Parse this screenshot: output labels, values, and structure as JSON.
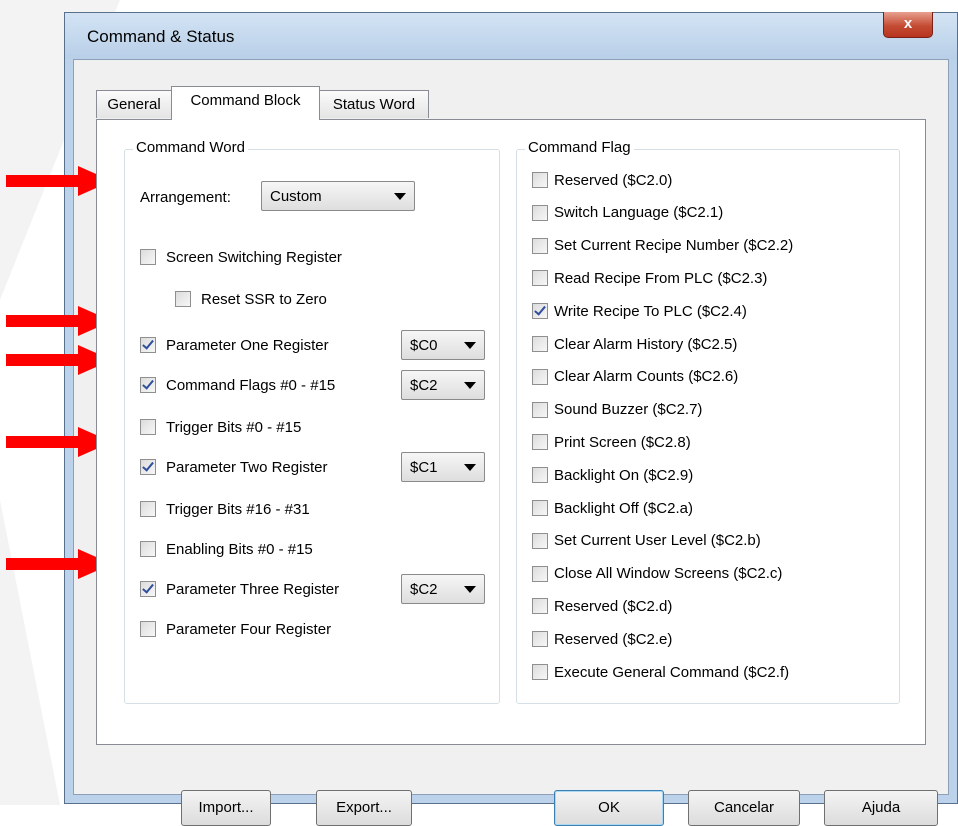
{
  "window": {
    "title": "Command & Status",
    "close_symbol": "x"
  },
  "tabs": [
    {
      "label": "General",
      "active": false
    },
    {
      "label": "Command Block",
      "active": true
    },
    {
      "label": "Status Word",
      "active": false
    }
  ],
  "command_word": {
    "legend": "Command Word",
    "arrangement_label": "Arrangement:",
    "arrangement_value": "Custom",
    "items": [
      {
        "label": "Screen Switching Register",
        "checked": false,
        "combo": null
      },
      {
        "label": "Reset SSR to Zero",
        "checked": false,
        "combo": null
      },
      {
        "label": "Parameter One Register",
        "checked": true,
        "combo": "$C0"
      },
      {
        "label": "Command Flags #0 - #15",
        "checked": true,
        "combo": "$C2"
      },
      {
        "label": "Trigger Bits #0 - #15",
        "checked": false,
        "combo": null
      },
      {
        "label": "Parameter Two Register",
        "checked": true,
        "combo": "$C1"
      },
      {
        "label": "Trigger Bits #16 - #31",
        "checked": false,
        "combo": null
      },
      {
        "label": "Enabling Bits #0 - #15",
        "checked": false,
        "combo": null
      },
      {
        "label": "Parameter Three Register",
        "checked": true,
        "combo": "$C2"
      },
      {
        "label": "Parameter Four Register",
        "checked": false,
        "combo": null
      }
    ]
  },
  "command_flag": {
    "legend": "Command Flag",
    "items": [
      {
        "label": "Reserved ($C2.0)",
        "checked": false
      },
      {
        "label": "Switch Language ($C2.1)",
        "checked": false
      },
      {
        "label": "Set Current Recipe Number ($C2.2)",
        "checked": false
      },
      {
        "label": "Read Recipe From PLC ($C2.3)",
        "checked": false
      },
      {
        "label": "Write Recipe To PLC ($C2.4)",
        "checked": true
      },
      {
        "label": "Clear Alarm History ($C2.5)",
        "checked": false
      },
      {
        "label": "Clear Alarm Counts ($C2.6)",
        "checked": false
      },
      {
        "label": "Sound Buzzer ($C2.7)",
        "checked": false
      },
      {
        "label": "Print Screen ($C2.8)",
        "checked": false
      },
      {
        "label": "Backlight On ($C2.9)",
        "checked": false
      },
      {
        "label": "Backlight Off ($C2.a)",
        "checked": false
      },
      {
        "label": "Set Current User Level ($C2.b)",
        "checked": false
      },
      {
        "label": "Close All Window Screens ($C2.c)",
        "checked": false
      },
      {
        "label": "Reserved ($C2.d)",
        "checked": false
      },
      {
        "label": "Reserved ($C2.e)",
        "checked": false
      },
      {
        "label": "Execute General Command ($C2.f)",
        "checked": false
      }
    ]
  },
  "buttons": {
    "import": "Import...",
    "export": "Export...",
    "ok": "OK",
    "cancel": "Cancelar",
    "help": "Ajuda"
  },
  "colors": {
    "arrow": "#ff0000",
    "titlebar": "#bcd2ea",
    "close_button": "#c44c34"
  }
}
